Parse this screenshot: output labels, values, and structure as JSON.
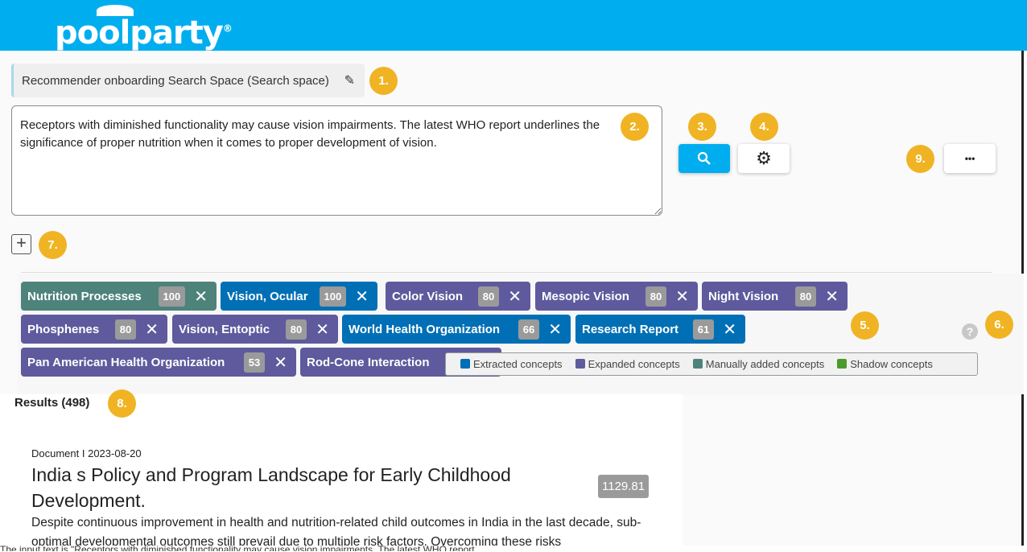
{
  "header": {
    "logo": "poolparty",
    "logo_mark": "®"
  },
  "search_space": {
    "label": "Recommender onboarding Search Space (Search space)"
  },
  "input": {
    "value": "Receptors with diminished functionality may cause vision impairments. The latest WHO report underlines the significance of proper nutrition when it comes to proper development of vision."
  },
  "badges": [
    "1.",
    "2.",
    "3.",
    "4.",
    "5.",
    "6.",
    "7.",
    "8.",
    "9."
  ],
  "buttons": {
    "search": "search-icon",
    "settings": "gear-icon",
    "more": "•••",
    "add": "+"
  },
  "colors": {
    "extracted": "#006fb5",
    "expanded": "#5f5a9d",
    "manual": "#4e837c",
    "shadow": "#4c9a2a",
    "header": "#00aeef",
    "badge": "#f0b323"
  },
  "tags": [
    {
      "label": "Nutrition Processes",
      "score": "100",
      "type": "manual"
    },
    {
      "label": "Vision, Ocular",
      "score": "100",
      "type": "extracted"
    },
    {
      "label": "Color Vision",
      "score": "80",
      "type": "expanded"
    },
    {
      "label": "Mesopic Vision",
      "score": "80",
      "type": "expanded"
    },
    {
      "label": "Night Vision",
      "score": "80",
      "type": "expanded"
    },
    {
      "label": "Phosphenes",
      "score": "80",
      "type": "expanded"
    },
    {
      "label": "Vision, Entoptic",
      "score": "80",
      "type": "expanded"
    },
    {
      "label": "World Health Organization",
      "score": "66",
      "type": "extracted"
    },
    {
      "label": "Research Report",
      "score": "61",
      "type": "extracted"
    },
    {
      "label": "Pan American Health Organization",
      "score": "53",
      "type": "expanded"
    },
    {
      "label": "Rod-Cone Interaction",
      "score": "",
      "type": "expanded"
    }
  ],
  "legend": [
    "Extracted concepts",
    "Expanded concepts",
    "Manually added concepts",
    "Shadow concepts"
  ],
  "help": "?",
  "results": {
    "label": "Results (498)",
    "items": [
      {
        "meta": "Document I 2023-08-20",
        "title": "India s Policy and Program Landscape for Early Childhood Development.",
        "score": "1129.81",
        "abstract": "Despite continuous improvement in health and nutrition-related child outcomes in India in the last decade, sub-optimal developmental outcomes still prevail due to multiple risk factors. Overcoming these risks"
      }
    ]
  },
  "footer_text": "The input text is \"Receptors with diminished functionality may cause vision impairments. The latest WHO report"
}
